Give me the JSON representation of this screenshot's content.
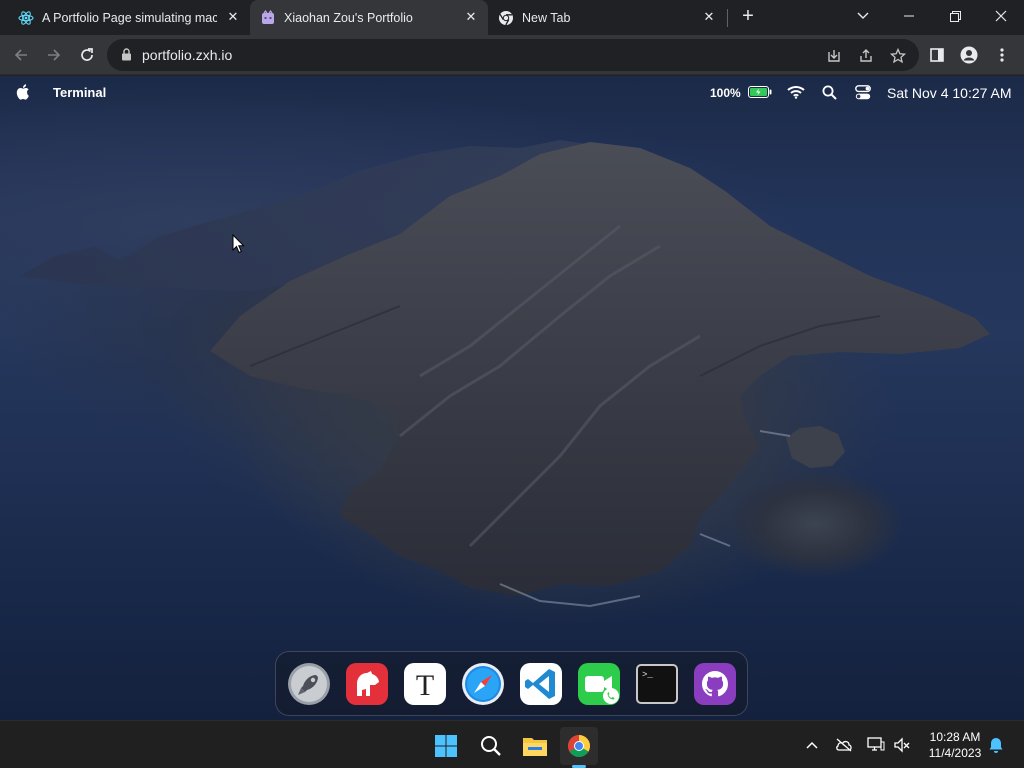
{
  "browser": {
    "tabs": [
      {
        "title": "A Portfolio Page simulating macOS",
        "icon": "react-icon",
        "active": false
      },
      {
        "title": "Xiaohan Zou's Portfolio",
        "icon": "portfolio-favicon",
        "active": true
      },
      {
        "title": "New Tab",
        "icon": "chrome-icon",
        "active": false
      }
    ],
    "new_tab_label": "+",
    "url": "portfolio.zxh.io"
  },
  "mac": {
    "menubar": {
      "app_name": "Terminal",
      "battery_percent": "100%",
      "datetime": "Sat Nov 4 10:27 AM"
    },
    "dock": [
      {
        "name": "launchpad-icon"
      },
      {
        "name": "bear-notes-icon"
      },
      {
        "name": "typora-icon"
      },
      {
        "name": "safari-icon"
      },
      {
        "name": "vscode-icon"
      },
      {
        "name": "facetime-icon"
      },
      {
        "name": "terminal-icon"
      },
      {
        "name": "github-icon"
      }
    ]
  },
  "taskbar": {
    "time": "10:28 AM",
    "date": "11/4/2023"
  },
  "colors": {
    "chrome_bg": "#202124",
    "chrome_toolbar": "#35363a",
    "taskbar_bg": "#202020",
    "accent_blue": "#4cc2ff"
  }
}
